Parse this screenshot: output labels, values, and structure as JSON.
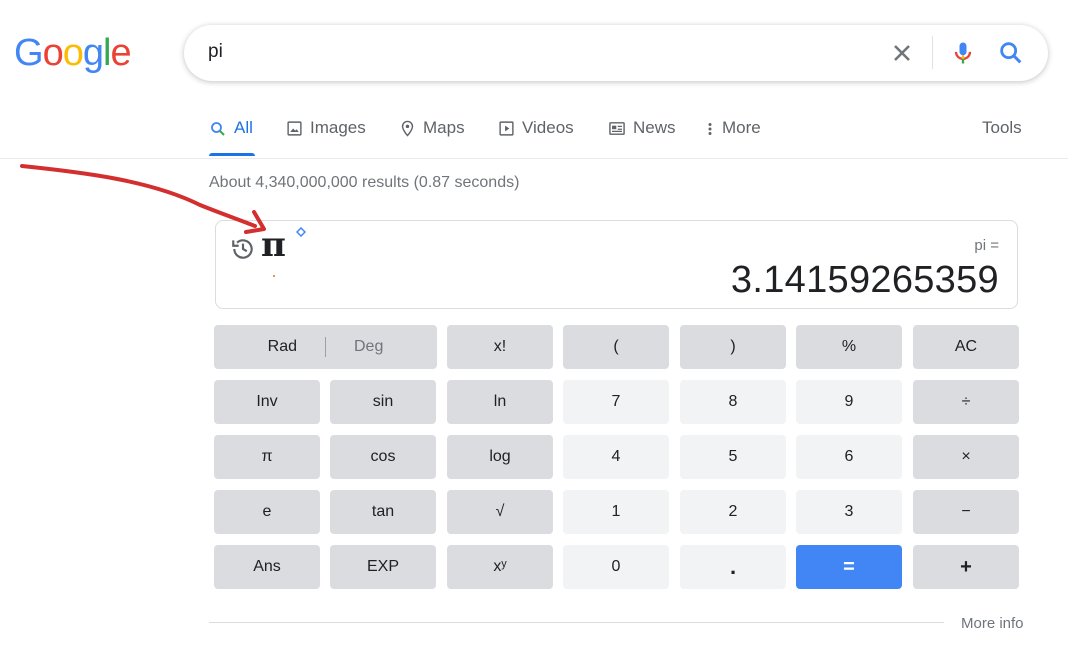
{
  "logo": {
    "text": "Google",
    "letters": [
      "G",
      "o",
      "o",
      "g",
      "l",
      "e"
    ],
    "colors": [
      "#4285f4",
      "#ea4335",
      "#fbbc05",
      "#4285f4",
      "#34a853",
      "#ea4335"
    ]
  },
  "search": {
    "value": "pi",
    "clear_icon": "close-icon",
    "mic_icon": "microphone-icon",
    "search_icon": "search-icon"
  },
  "tabs": [
    {
      "label": "All",
      "icon": "search-icon",
      "active": true
    },
    {
      "label": "Images",
      "icon": "image-icon"
    },
    {
      "label": "Maps",
      "icon": "map-pin-icon"
    },
    {
      "label": "Videos",
      "icon": "play-icon"
    },
    {
      "label": "News",
      "icon": "news-icon"
    },
    {
      "label": "More",
      "icon": "more-vert-icon"
    }
  ],
  "tools_label": "Tools",
  "result_stats": "About 4,340,000,000 results (0.87 seconds)",
  "calculator": {
    "history_symbol": "π",
    "expression": "pi =",
    "result": "3.14159265359",
    "keys": {
      "rad": "Rad",
      "deg": "Deg",
      "fact": "x!",
      "lparen": "(",
      "rparen": ")",
      "percent": "%",
      "ac": "AC",
      "inv": "Inv",
      "sin": "sin",
      "ln": "ln",
      "n7": "7",
      "n8": "8",
      "n9": "9",
      "div": "÷",
      "pi": "π",
      "cos": "cos",
      "log": "log",
      "n4": "4",
      "n5": "5",
      "n6": "6",
      "mul": "×",
      "e": "e",
      "tan": "tan",
      "sqrt": "√",
      "n1": "1",
      "n2": "2",
      "n3": "3",
      "minus": "−",
      "ans": "Ans",
      "exp": "EXP",
      "pow": "xʸ",
      "n0": "0",
      "dot": ".",
      "eq": "=",
      "plus": "+"
    },
    "accent_color": "#4285f4"
  },
  "more_info": "More info",
  "annotation_color": "#d32f2f"
}
